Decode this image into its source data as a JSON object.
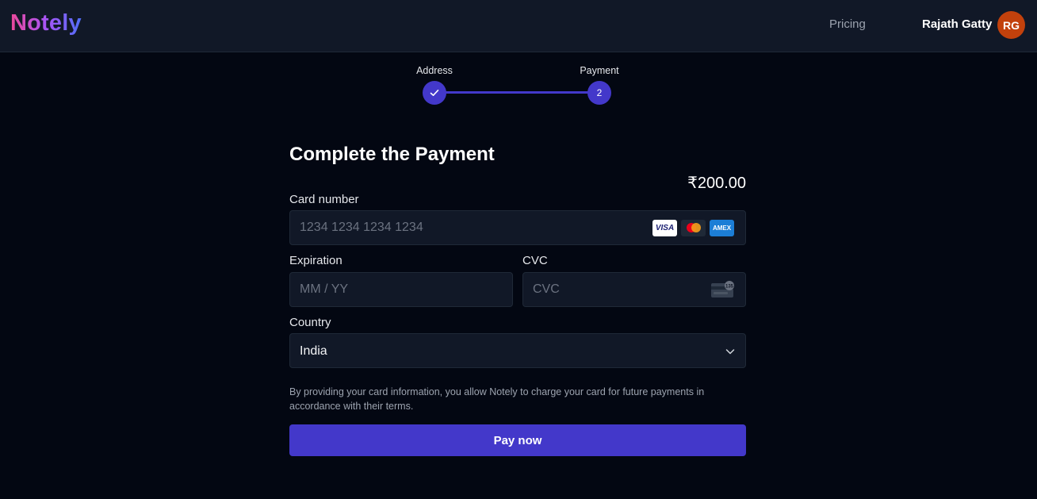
{
  "header": {
    "logo": "Notely",
    "nav_pricing": "Pricing",
    "user_name": "Rajath Gatty",
    "avatar_initials": "RG"
  },
  "stepper": {
    "steps": [
      {
        "label": "Address",
        "state": "complete",
        "icon": "check-icon"
      },
      {
        "label": "Payment",
        "state": "current",
        "number": "2"
      }
    ]
  },
  "payment": {
    "title": "Complete the Payment",
    "amount": "₹200.00",
    "card_number": {
      "label": "Card number",
      "placeholder": "1234 1234 1234 1234",
      "value": ""
    },
    "card_brands": [
      {
        "name": "visa-icon",
        "text": "VISA"
      },
      {
        "name": "mastercard-icon",
        "text": ""
      },
      {
        "name": "amex-icon",
        "text": "AMEX"
      }
    ],
    "expiration": {
      "label": "Expiration",
      "placeholder": "MM / YY",
      "value": ""
    },
    "cvc": {
      "label": "CVC",
      "placeholder": "CVC",
      "value": "",
      "icon_text": "135"
    },
    "country": {
      "label": "Country",
      "value": "India"
    },
    "terms": "By providing your card information, you allow Notely to charge your card for future payments in accordance with their terms.",
    "pay_button": "Pay now"
  },
  "colors": {
    "background": "#030712",
    "header": "#111827",
    "accent": "#4338ca",
    "avatar": "#c2410c"
  }
}
